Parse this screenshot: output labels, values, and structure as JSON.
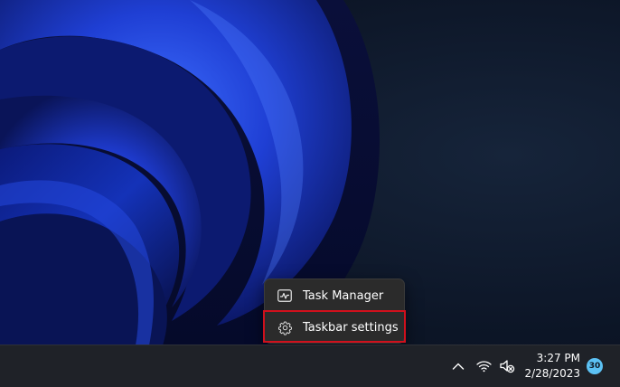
{
  "context_menu": {
    "items": [
      {
        "label": "Task Manager",
        "icon": "task-manager-icon"
      },
      {
        "label": "Taskbar settings",
        "icon": "gear-icon"
      }
    ],
    "highlighted_item": "Taskbar settings",
    "highlight_color": "#d0101c"
  },
  "taskbar": {
    "tray_icons": [
      "chevron-up-icon",
      "wifi-icon",
      "speaker-muted-icon"
    ],
    "clock": {
      "time": "3:27 PM",
      "date": "2/28/2023"
    },
    "notification_badge": "30",
    "badge_color": "#5cc2f5"
  }
}
